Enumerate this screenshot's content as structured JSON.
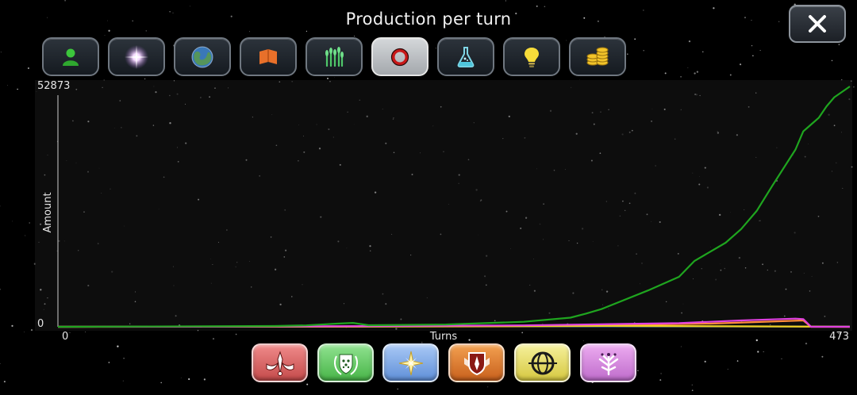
{
  "window": {
    "title": "Production per turn",
    "close_glyph": "✕"
  },
  "tabs": [
    {
      "icon": "population-icon",
      "label": "Population",
      "selected": false
    },
    {
      "icon": "star-icon",
      "label": "Stars",
      "selected": false
    },
    {
      "icon": "planet-icon",
      "label": "Planets",
      "selected": false
    },
    {
      "icon": "territory-icon",
      "label": "Territory",
      "selected": false
    },
    {
      "icon": "food-icon",
      "label": "Food",
      "selected": false
    },
    {
      "icon": "production-icon",
      "label": "Production",
      "selected": true
    },
    {
      "icon": "science-icon",
      "label": "Science",
      "selected": false
    },
    {
      "icon": "influence-icon",
      "label": "Influence",
      "selected": false
    },
    {
      "icon": "money-icon",
      "label": "Money",
      "selected": false
    }
  ],
  "chart_data": {
    "type": "line",
    "title": "Production per turn",
    "xlabel": "Turns",
    "ylabel": "Amount",
    "xlim": [
      0,
      473
    ],
    "ylim": [
      0,
      52873
    ],
    "x_ticks": [
      "0",
      "473"
    ],
    "y_ticks": [
      "0",
      "52873"
    ],
    "grid": false,
    "series": [
      {
        "color": "#1fa51f",
        "points": [
          [
            0,
            0
          ],
          [
            140,
            180
          ],
          [
            160,
            320
          ],
          [
            180,
            700
          ],
          [
            190,
            850
          ],
          [
            200,
            350
          ],
          [
            250,
            510
          ],
          [
            300,
            1100
          ],
          [
            330,
            2000
          ],
          [
            340,
            2900
          ],
          [
            350,
            3900
          ],
          [
            380,
            8000
          ],
          [
            400,
            11000
          ],
          [
            410,
            14500
          ],
          [
            430,
            18500
          ],
          [
            440,
            21500
          ],
          [
            450,
            25500
          ],
          [
            460,
            31000
          ],
          [
            475,
            39000
          ],
          [
            480,
            43000
          ],
          [
            485,
            44500
          ],
          [
            490,
            46000
          ],
          [
            495,
            48500
          ],
          [
            500,
            50500
          ],
          [
            510,
            52873
          ]
        ]
      },
      {
        "color": "#e040e0",
        "points": [
          [
            0,
            0
          ],
          [
            100,
            30
          ],
          [
            200,
            150
          ],
          [
            300,
            320
          ],
          [
            400,
            800
          ],
          [
            440,
            1400
          ],
          [
            475,
            1800
          ],
          [
            480,
            1700
          ],
          [
            485,
            0
          ],
          [
            510,
            0
          ]
        ]
      },
      {
        "color": "#f0d020",
        "points": [
          [
            0,
            0
          ],
          [
            200,
            40
          ],
          [
            300,
            120
          ],
          [
            350,
            200
          ],
          [
            400,
            160
          ],
          [
            450,
            80
          ],
          [
            510,
            0
          ]
        ]
      },
      {
        "color": "#ff8c3c",
        "points": [
          [
            0,
            0
          ],
          [
            200,
            80
          ],
          [
            300,
            250
          ],
          [
            380,
            500
          ],
          [
            420,
            700
          ],
          [
            480,
            1400
          ],
          [
            485,
            0
          ],
          [
            510,
            0
          ]
        ]
      },
      {
        "color": "#3a7fd0",
        "points": [
          [
            0,
            0
          ],
          [
            150,
            50
          ],
          [
            300,
            120
          ],
          [
            510,
            60
          ]
        ]
      }
    ]
  },
  "civilizations": [
    {
      "icon": "civ-red-emblem-icon",
      "color": "#e06a6a"
    },
    {
      "icon": "civ-green-wreath-icon",
      "color": "#6fcf6f"
    },
    {
      "icon": "civ-blue-star-icon",
      "color": "#7ea9e8"
    },
    {
      "icon": "civ-orange-shield-icon",
      "color": "#e6862f"
    },
    {
      "icon": "civ-yellow-globe-icon",
      "color": "#e8e070"
    },
    {
      "icon": "civ-purple-tree-icon",
      "color": "#d889e0"
    }
  ]
}
